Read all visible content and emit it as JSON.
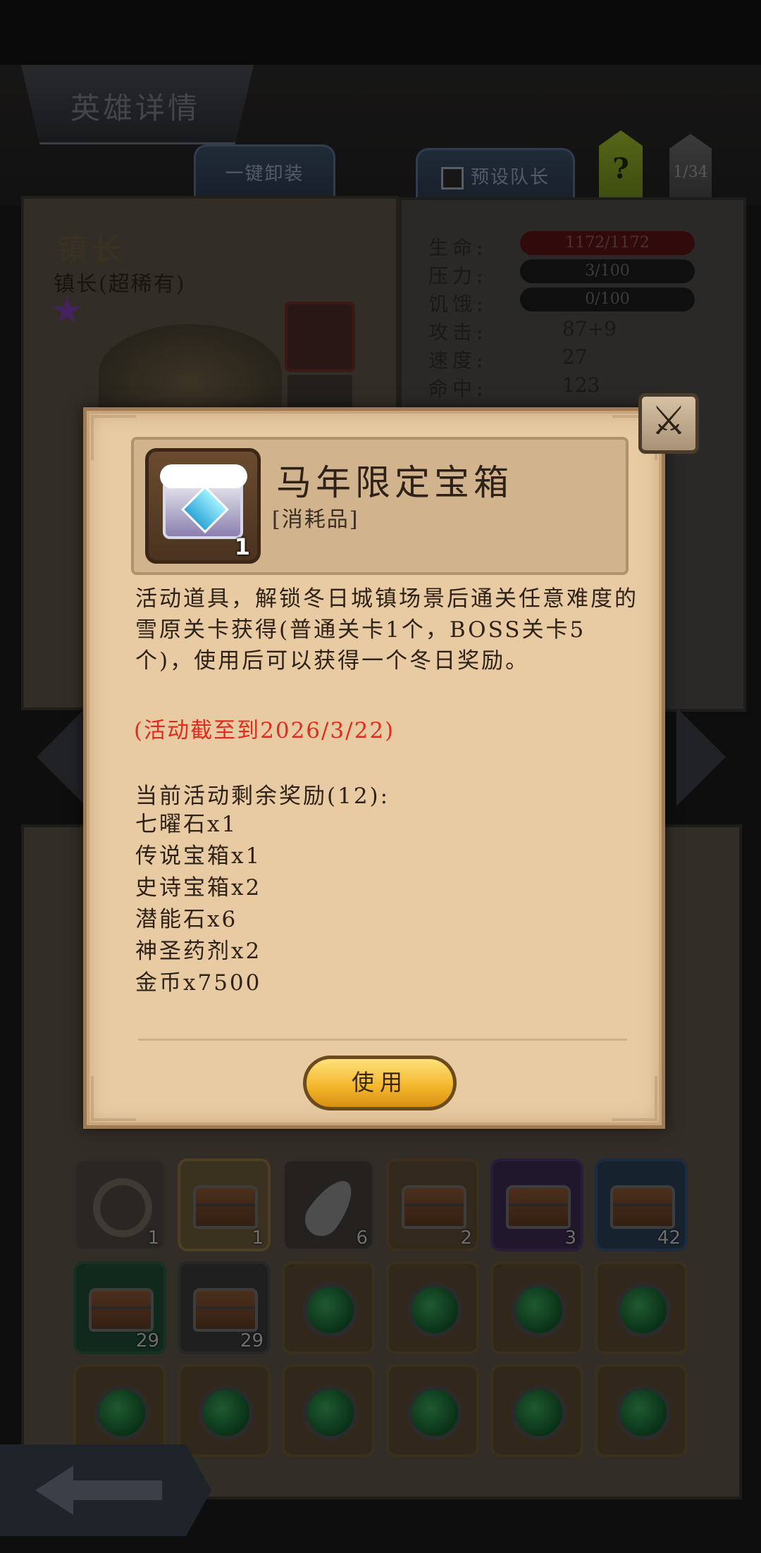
{
  "background": {
    "page_title": "英雄详情",
    "unequip_all_label": "一键卸装",
    "preset_leader_label": "预设队长",
    "help_label": "?",
    "page_counter": "1/34",
    "hero": {
      "name": "镇长",
      "subtitle": "镇长(超稀有)",
      "stats": [
        {
          "label": "生命:",
          "value": "1172/1172",
          "style": "bar-red"
        },
        {
          "label": "压力:",
          "value": "3/100",
          "style": "bar"
        },
        {
          "label": "饥饿:",
          "value": "0/100",
          "style": "bar"
        },
        {
          "label": "攻击:",
          "value": "87+9",
          "style": "text"
        },
        {
          "label": "速度:",
          "value": "27",
          "style": "text"
        },
        {
          "label": "命中:",
          "value": "123",
          "style": "text"
        }
      ]
    },
    "inventory_counts": [
      "1",
      "1",
      "6",
      "2",
      "3",
      "42",
      "29",
      "29"
    ]
  },
  "modal": {
    "item_name": "马年限定宝箱",
    "item_type": "[消耗品]",
    "item_count": "1",
    "description": "活动道具，解锁冬日城镇场景后通关任意难度的雪原关卡获得(普通关卡1个，BOSS关卡5个)，使用后可以获得一个冬日奖励。",
    "deadline": "(活动截至到2026/3/22)",
    "remaining_title": "当前活动剩余奖励(12):",
    "rewards": [
      "七曜石x1",
      "传说宝箱x1",
      "史诗宝箱x2",
      "潜能石x6",
      "神圣药剂x2",
      "金币x7500"
    ],
    "use_label": "使用",
    "close_icon": "crossed-swords-close-icon"
  }
}
